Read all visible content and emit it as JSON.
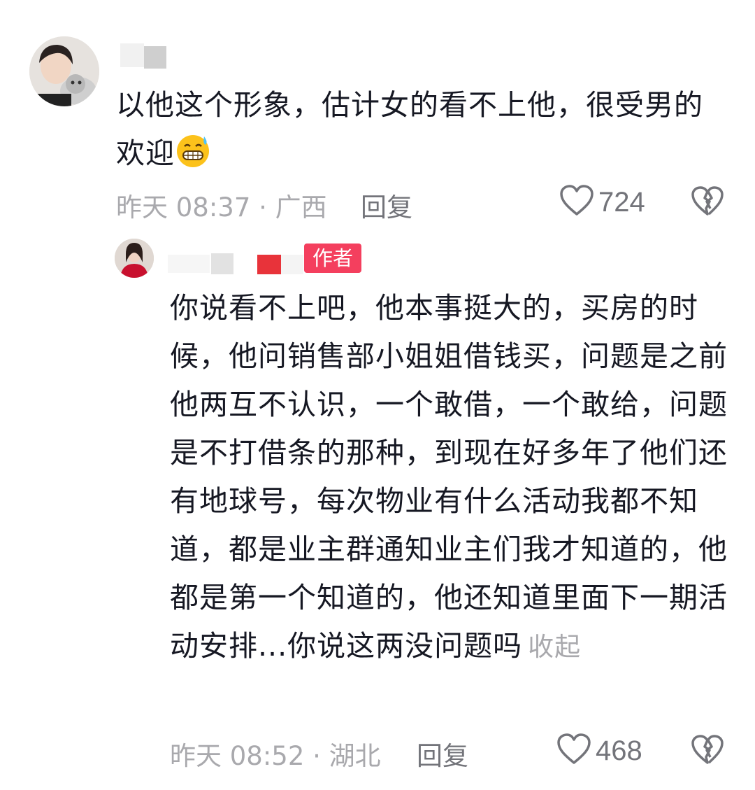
{
  "comments": [
    {
      "text": "以他这个形象，估计女的看不上他，很受男的欢迎",
      "emoji": "grimacing-sweat-emoji",
      "time_location": "昨天 08:37 · 广西",
      "reply_label": "回复",
      "likes": "724"
    }
  ],
  "reply": {
    "author_badge": "作者",
    "text": "你说看不上吧，他本事挺大的，买房的时候，他问销售部小姐姐借钱买，问题是之前他两互不认识，一个敢借，一个敢给，问题是不打借条的那种，到现在好多年了他们还有地球号，每次物业有什么活动我都不知道，都是业主群通知业主们我才知道的，他都是第一个知道的，他还知道里面下一期活动安排...你说这两没问题吗",
    "collapse_label": "收起",
    "time_location": "昨天 08:52 · 湖北",
    "reply_label": "回复",
    "likes": "468"
  },
  "colors": {
    "text": "#161823",
    "meta": "#a9a9ad",
    "badge": "#f43f5e"
  }
}
